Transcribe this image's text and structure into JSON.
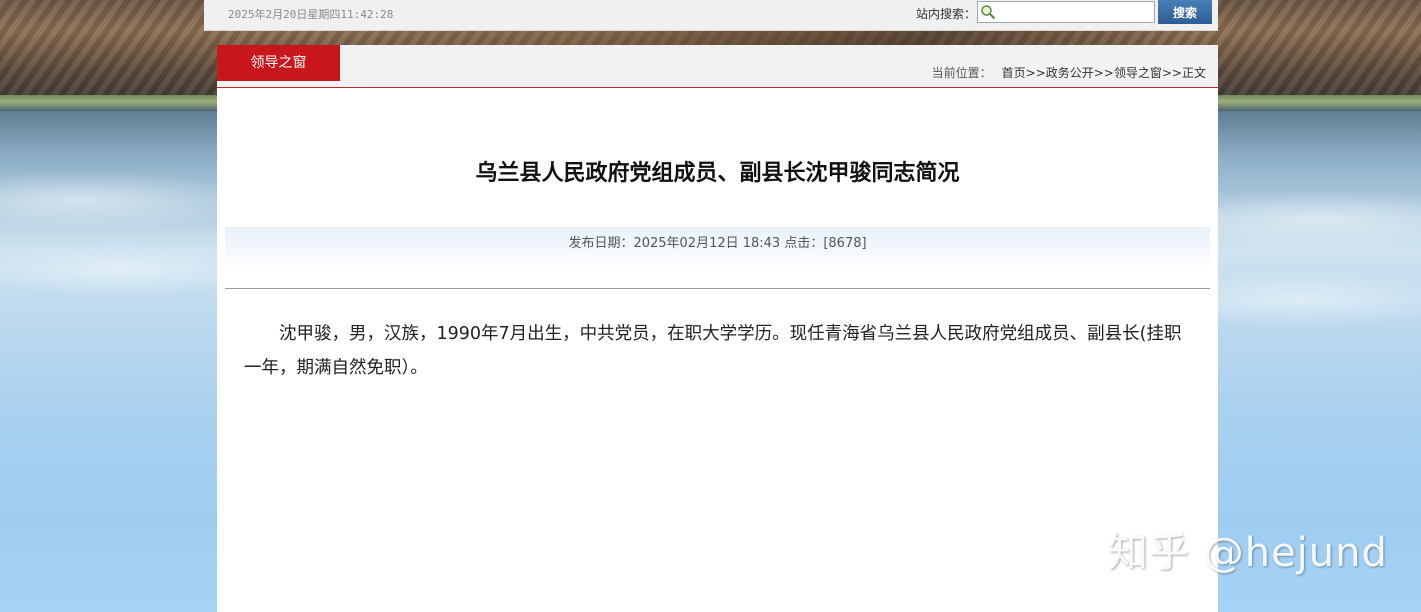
{
  "topbar": {
    "datetime": "2025年2月20日星期四11:42:28",
    "search_label": "站内搜索：",
    "search_placeholder": "",
    "search_button": "搜索"
  },
  "section": {
    "tab_label": "领导之窗"
  },
  "breadcrumb": {
    "label": "当前位置：",
    "items": [
      "首页",
      "政务公开",
      "领导之窗",
      "正文"
    ],
    "separator": ">>"
  },
  "article": {
    "title": "乌兰县人民政府党组成员、副县长沈甲骏同志简况",
    "meta": "发布日期：2025年02月12日 18:43  点击：[8678]",
    "body": "沈甲骏，男，汉族，1990年7月出生，中共党员，在职大学学历。现任青海省乌兰县人民政府党组成员、副县长(挂职一年，期满自然免职）。"
  },
  "watermark": "知乎 @hejund",
  "colors": {
    "accent_red": "#c8161d",
    "search_button_blue": "#3a6ea5"
  }
}
